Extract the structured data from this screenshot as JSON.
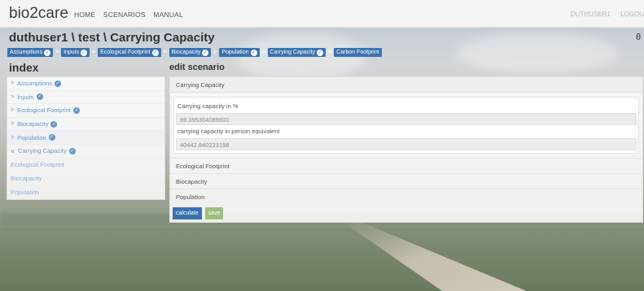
{
  "nav": {
    "brand": "bio2care",
    "links": [
      "HOME",
      "SCENARIOS",
      "MANUAL"
    ],
    "user": "DUTHUSER1",
    "logout": "LOGOU"
  },
  "page": {
    "title": "duthuser1 \\ test \\ Carrying Capacity",
    "top_icon": "θ"
  },
  "breadcrumb": [
    {
      "label": "Assumptions",
      "check": true
    },
    {
      "label": "Inputs",
      "check": true
    },
    {
      "label": "Ecological Footprint",
      "check": true
    },
    {
      "label": "Biocapacity",
      "check": true
    },
    {
      "label": "Population",
      "check": true
    },
    {
      "label": "Carrying Capacity",
      "check": true
    },
    {
      "label": "Carbon Footprint",
      "check": false
    }
  ],
  "index": {
    "heading": "index",
    "items": [
      {
        "label": "Assumptions",
        "arrow": ">",
        "check": true
      },
      {
        "label": "Inputs",
        "arrow": ">",
        "check": true
      },
      {
        "label": "Ecological Footprint",
        "arrow": ">",
        "check": true
      },
      {
        "label": "Biocapacity",
        "arrow": ">",
        "check": true
      },
      {
        "label": "Population",
        "arrow": ">",
        "check": true
      },
      {
        "label": "Carrying Capacity",
        "arrow": "∨",
        "check": true
      }
    ],
    "subitems": [
      "Ecological Footprint",
      "Biocapacity",
      "Population"
    ]
  },
  "edit": {
    "heading": "edit scenario",
    "section_title": "Carrying Capacity",
    "fields": [
      {
        "label": "Carrying capacity in %",
        "value": "89.395304089603"
      },
      {
        "label": "carrying capacity in person equivalent",
        "value": "40442.840223198"
      }
    ],
    "collapsed_sections": [
      "Ecological Footprint",
      "Biocapacity",
      "Population"
    ],
    "buttons": {
      "calculate": "calculate",
      "save": "save"
    }
  },
  "icons": {
    "check": "✓",
    "sep": ">"
  },
  "colors": {
    "accent": "#3a72b0",
    "save": "#9fbf7e",
    "link": "#6a97c6"
  }
}
